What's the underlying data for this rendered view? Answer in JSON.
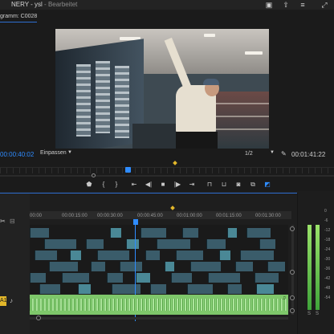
{
  "window": {
    "title": "NERY - ysl",
    "status": " - Bearbeitet"
  },
  "monitor": {
    "tab_label": "gramm: C0028",
    "current_timecode": "00:00:40:02",
    "fit_label": "Einpassen",
    "resolution_label": "1/2",
    "duration_timecode": "00:01:41:22"
  },
  "timeline": {
    "ruler_ticks": [
      "00:00",
      "00:00:15:00",
      "00:00:30:00",
      "00:00:45:00",
      "00:01:00:00",
      "00:01:15:00",
      "00:01:30:00"
    ],
    "track_label": "A1",
    "meter_labels": [
      "0",
      "-6",
      "-12",
      "-18",
      "-24",
      "-30",
      "-36",
      "-42",
      "-48",
      "-54"
    ],
    "meter_solo": "S"
  },
  "icons": {
    "play_icon": "▶",
    "stop_icon": "■",
    "step_back_icon": "◀|",
    "step_forward_icon": "|▶",
    "mark_in_icon": "{",
    "mark_out_icon": "}",
    "wrench_icon": "wrench",
    "camera_icon": "camera"
  },
  "colors": {
    "accent": "#2f8cff",
    "audio_clip": "#7ec76a",
    "video_clip": "#3a5c6a",
    "track_label": "#e3b72a"
  }
}
